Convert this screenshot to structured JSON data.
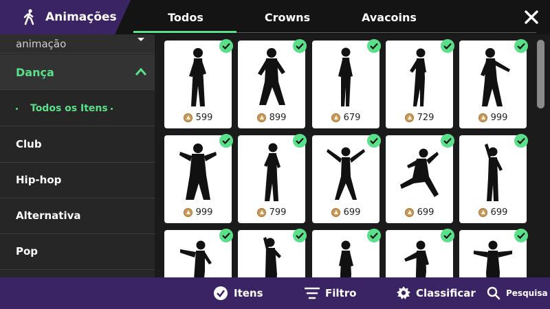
{
  "header": {
    "title": "Animações",
    "tabs": [
      "Todos",
      "Crowns",
      "Avacoins"
    ],
    "active_tab": "Todos",
    "close_icon": "close-icon"
  },
  "sidebar": {
    "partial_top": "animação",
    "category": "Dança",
    "sub_item": "Todos os Itens",
    "items": [
      "Club",
      "Hip-hop",
      "Alternativa",
      "Pop"
    ]
  },
  "grid": {
    "prices": [
      "599",
      "899",
      "679",
      "729",
      "999",
      "999",
      "799",
      "699",
      "699",
      "699",
      "",
      "",
      "",
      "",
      ""
    ],
    "owned_check": true,
    "accent": "#5ae08a"
  },
  "bottom": {
    "itens": "Itens",
    "filtro": "Filtro",
    "classificar": "Classificar",
    "pesquisa": "Pesquisa"
  },
  "colors": {
    "purple": "#3b2463",
    "green": "#5ae08a",
    "coin": "#c9985a"
  }
}
